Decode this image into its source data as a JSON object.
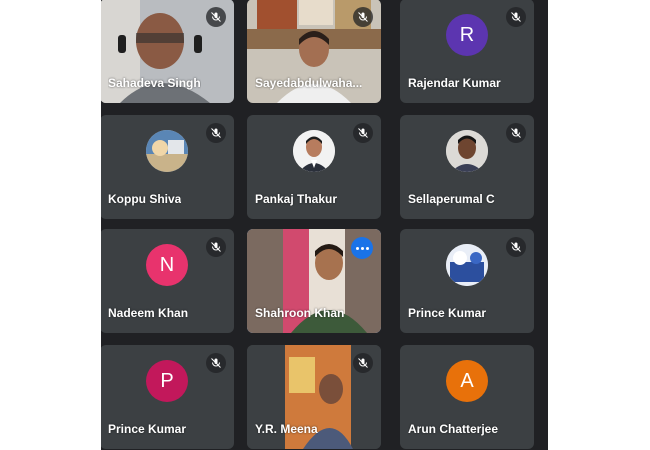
{
  "participants": [
    {
      "name": "Sahadeva Singh",
      "type": "video",
      "muted": true
    },
    {
      "name": "Sayedabdulwaha...",
      "type": "video",
      "muted": true
    },
    {
      "name": "Rajendar Kumar",
      "type": "letter",
      "initial": "R",
      "color": "#5c35b0",
      "muted": true
    },
    {
      "name": "Koppu Shiva",
      "type": "photo",
      "muted": true
    },
    {
      "name": "Pankaj Thakur",
      "type": "photo",
      "muted": true
    },
    {
      "name": "Sellaperumal C",
      "type": "photo",
      "muted": true
    },
    {
      "name": "Nadeem Khan",
      "type": "letter",
      "initial": "N",
      "color": "#e8336d",
      "muted": true
    },
    {
      "name": "Shahroon Khan",
      "type": "video",
      "muted": false,
      "active": true
    },
    {
      "name": "Prince Kumar",
      "type": "photo",
      "muted": true
    },
    {
      "name": "Prince Kumar",
      "type": "letter",
      "initial": "P",
      "color": "#c2185b",
      "muted": true
    },
    {
      "name": "Y.R. Meena",
      "type": "video",
      "muted": true
    },
    {
      "name": "Arun Chatterjee",
      "type": "letter",
      "initial": "A",
      "color": "#e8710a",
      "muted": false
    }
  ],
  "colors": {
    "tile_bg": "#3c4043",
    "grid_bg": "#202124",
    "active_border": "#8ab4f8",
    "more_button": "#1a73e8"
  },
  "icons": {
    "muted": "mic-off-icon",
    "more": "more-options-icon"
  }
}
